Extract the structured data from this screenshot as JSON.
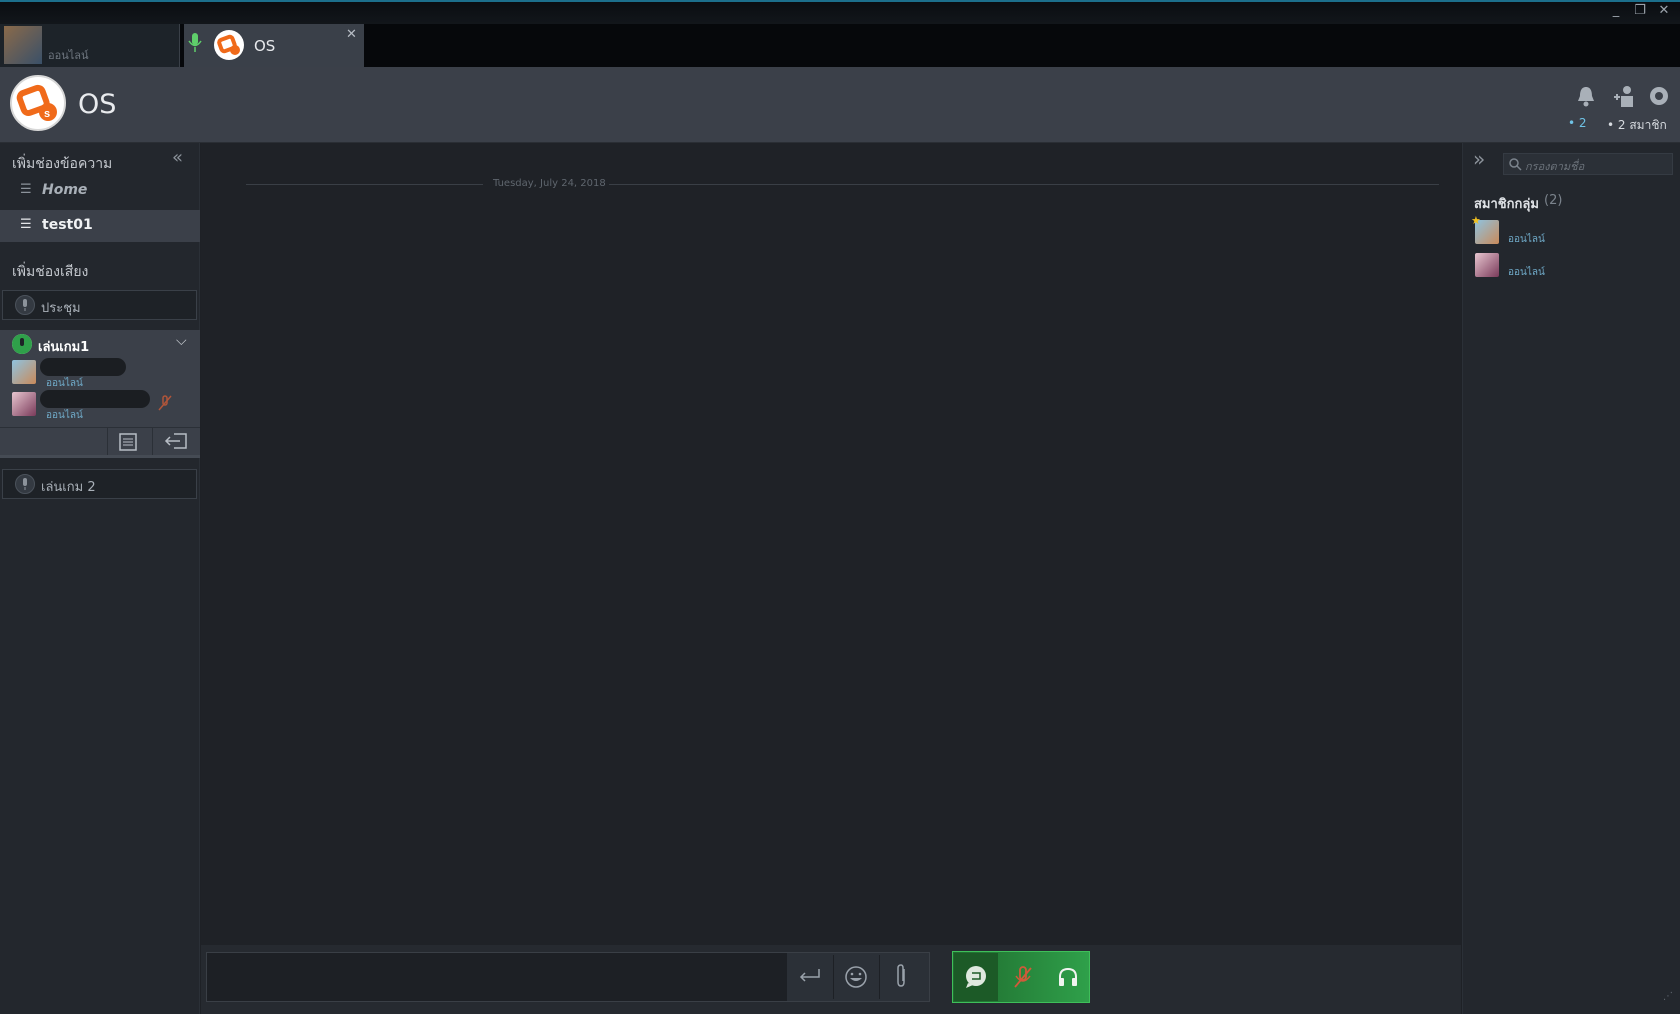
{
  "tabs": {
    "user_tab_status": "ออนไลน์",
    "server_tab_name": "OS"
  },
  "header": {
    "server_name": "OS",
    "notification_count": "• 2",
    "member_count": "• 2 สมาชิก"
  },
  "sidebar": {
    "text_channels_heading": "เพิ่มช่องข้อความ",
    "text_channels": [
      {
        "label": "Home"
      },
      {
        "label": "test01"
      }
    ],
    "voice_channels_heading": "เพิ่มช่องเสียง",
    "voice_channels": [
      {
        "label": "ประชุม"
      },
      {
        "label": "เล่นเกม1"
      },
      {
        "label": "เล่นเกม 2"
      }
    ],
    "voice_members": [
      {
        "status": "ออนไลน์"
      },
      {
        "status": "ออนไลน์"
      }
    ]
  },
  "main": {
    "date_divider": "Tuesday, July 24, 2018"
  },
  "right_panel": {
    "search_placeholder": "กรองตามชื่อ",
    "members_heading": "สมาชิกกลุ่ม",
    "members_count": "(2)",
    "members": [
      {
        "status": "ออนไลน์"
      },
      {
        "status": "ออนไลน์"
      }
    ]
  },
  "colors": {
    "accent_green": "#2fa04a",
    "online_text": "#6fa9c7",
    "brand_orange": "#f06a1a"
  }
}
